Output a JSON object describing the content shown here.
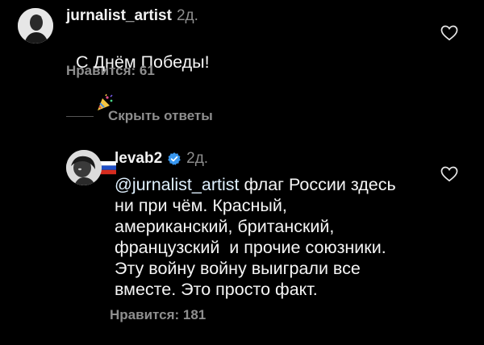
{
  "comments": [
    {
      "username": "jurnalist_artist",
      "time": "2д.",
      "text": "С Днём Победы!",
      "emojis": [
        "party-popper",
        "russian-flag"
      ],
      "likes": "Нравится: 61",
      "like_icon": "heart-outline-icon"
    },
    {
      "username": "levab2",
      "verified": true,
      "time": "2д.",
      "mention": "@jurnalist_artist",
      "text": " флаг России здесь\nни при чём. Красный,\nамериканский, британский,\nфранцузский  и прочие союзники.\nЭту войну войну выиграли все\nвместе. Это просто факт.",
      "likes": "Нравится: 181",
      "like_icon": "heart-outline-icon"
    }
  ],
  "hide_replies_label": "Скрыть ответы",
  "colors": {
    "background": "#000000",
    "text": "#f5f5f5",
    "muted": "#8e8e8e",
    "verified": "#3897f0"
  }
}
